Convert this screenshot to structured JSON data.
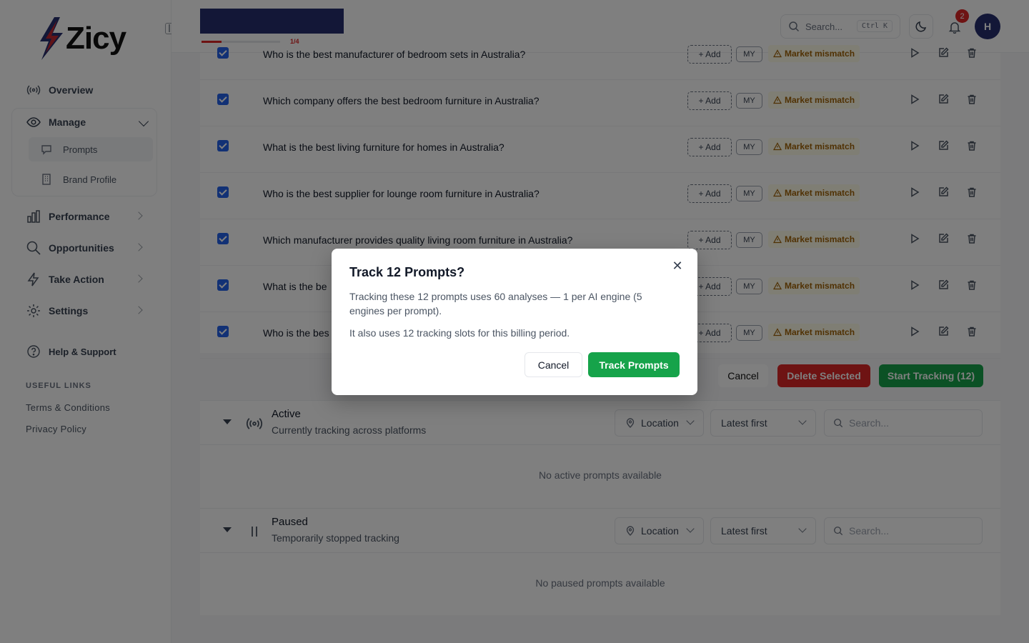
{
  "brand": {
    "name": "Zicy"
  },
  "header": {
    "progress_label": "1/4",
    "progress_fraction": 0.25,
    "search_placeholder": "Search...",
    "shortcut": "Ctrl K",
    "notification_count": "2",
    "avatar_initial": "H"
  },
  "sidebar": {
    "overview": "Overview",
    "manage": "Manage",
    "prompts": "Prompts",
    "brand_profile": "Brand Profile",
    "performance": "Performance",
    "opportunities": "Opportunities",
    "take_action": "Take Action",
    "settings": "Settings",
    "help": "Help & Support",
    "useful_links": "USEFUL LINKS",
    "terms": "Terms & Conditions",
    "privacy": "Privacy Policy"
  },
  "prompts": {
    "rows": [
      {
        "text": "Who is the best manufacturer of bedroom sets in Australia?",
        "add": "+ Add",
        "market": "MY",
        "warning": "Market mismatch"
      },
      {
        "text": "Which company offers the best bedroom furniture in Australia?",
        "add": "+ Add",
        "market": "MY",
        "warning": "Market mismatch"
      },
      {
        "text": "What is the best living furniture for homes in Australia?",
        "add": "+ Add",
        "market": "MY",
        "warning": "Market mismatch"
      },
      {
        "text": "Who is the best supplier for lounge room furniture in Australia?",
        "add": "+ Add",
        "market": "MY",
        "warning": "Market mismatch"
      },
      {
        "text": "Which manufacturer provides quality living room furniture in Australia?",
        "add": "+ Add",
        "market": "MY",
        "warning": "Market mismatch"
      },
      {
        "text": "What is the be",
        "add": "+ Add",
        "market": "MY",
        "warning": "Market mismatch"
      },
      {
        "text": "Who is the bes",
        "add": "+ Add",
        "market": "MY",
        "warning": "Market mismatch"
      }
    ],
    "cancel": "Cancel",
    "delete_selected": "Delete Selected",
    "start_tracking": "Start Tracking (12)"
  },
  "sections": {
    "active": {
      "title": "Active",
      "subtitle": "Currently tracking across platforms",
      "location": "Location",
      "sort": "Latest first",
      "search_placeholder": "Search...",
      "empty": "No active prompts available"
    },
    "paused": {
      "title": "Paused",
      "subtitle": "Temporarily stopped tracking",
      "location": "Location",
      "sort": "Latest first",
      "search_placeholder": "Search...",
      "empty": "No paused prompts available"
    }
  },
  "modal": {
    "title": "Track 12 Prompts?",
    "body1": "Tracking these 12 prompts uses 60 analyses — 1 per AI engine (5 engines per prompt).",
    "body2": "It also uses 12 tracking slots for this billing period.",
    "cancel": "Cancel",
    "confirm": "Track Prompts",
    "close_symbol": "✕"
  },
  "colors": {
    "brand_navy": "#262f6e",
    "primary_green": "#16a34a",
    "danger_red": "#dc2626",
    "checkbox_blue": "#2563eb",
    "warning_amber": "#a16207"
  }
}
